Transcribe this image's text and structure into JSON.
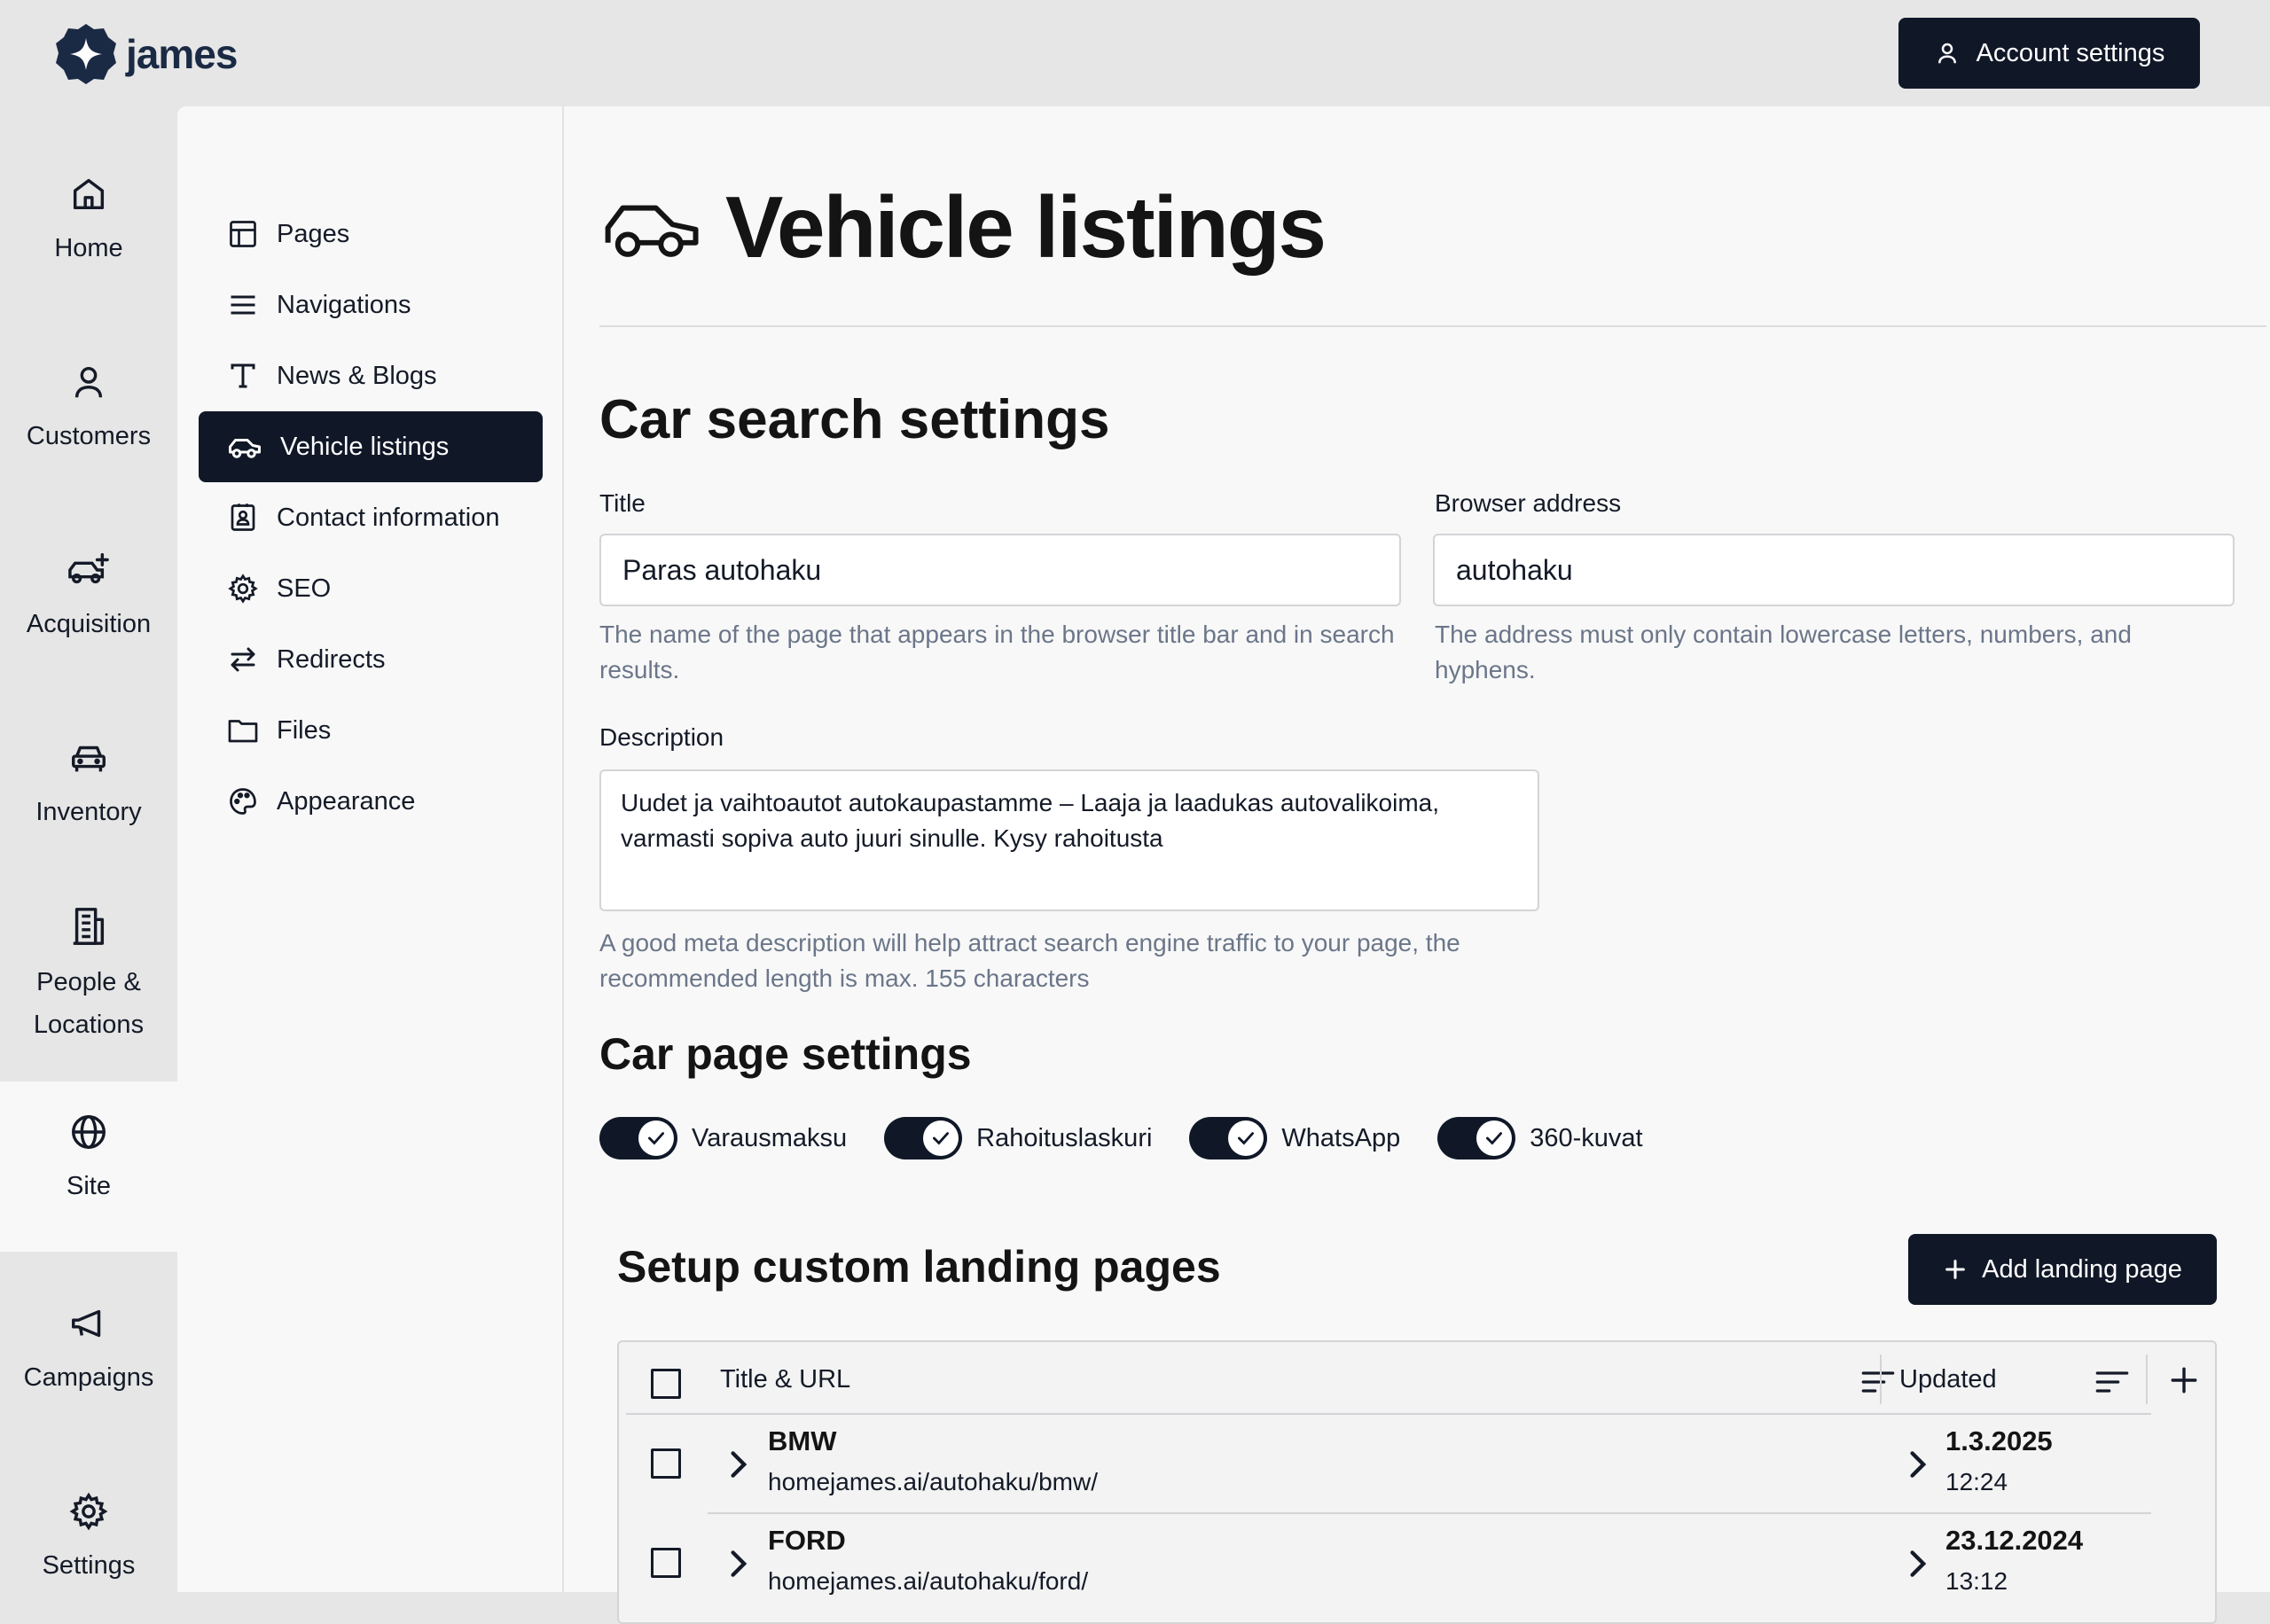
{
  "brand": {
    "name": "james"
  },
  "header": {
    "account_settings": "Account settings"
  },
  "rail": {
    "items": [
      {
        "label": "Home",
        "icon": "home-icon"
      },
      {
        "label": "Customers",
        "icon": "user-icon"
      },
      {
        "label": "Acquisition",
        "icon": "car-plus-icon"
      },
      {
        "label": "Inventory",
        "icon": "car-front-icon"
      },
      {
        "label": "People & Locations",
        "icon": "building-icon"
      },
      {
        "label": "Site",
        "icon": "globe-icon",
        "active": true
      },
      {
        "label": "Campaigns",
        "icon": "megaphone-icon"
      },
      {
        "label": "Settings",
        "icon": "gear-icon"
      }
    ]
  },
  "subnav": {
    "items": [
      {
        "label": "Pages",
        "icon": "layout-icon"
      },
      {
        "label": "Navigations",
        "icon": "menu-icon"
      },
      {
        "label": "News & Blogs",
        "icon": "text-icon"
      },
      {
        "label": "Vehicle listings",
        "icon": "car-icon",
        "active": true
      },
      {
        "label": "Contact information",
        "icon": "contact-card-icon"
      },
      {
        "label": "SEO",
        "icon": "gear-icon"
      },
      {
        "label": "Redirects",
        "icon": "arrows-icon"
      },
      {
        "label": "Files",
        "icon": "folder-icon"
      },
      {
        "label": "Appearance",
        "icon": "palette-icon"
      }
    ]
  },
  "main": {
    "page_title": "Vehicle listings",
    "car_search": {
      "heading": "Car search settings",
      "title_label": "Title",
      "title_value": "Paras autohaku",
      "title_help": "The name of the page that appears in the browser title bar and in search results.",
      "address_label": "Browser address",
      "address_value": "autohaku",
      "address_help": "The address must only contain lowercase letters, numbers, and hyphens.",
      "description_label": "Description",
      "description_value": "Uudet ja vaihtoautot autokaupastamme – Laaja ja laadukas autovalikoima, varmasti sopiva auto juuri sinulle. Kysy rahoitusta",
      "description_help": "A good meta description will help attract search engine traffic to your page, the recommended length is max. 155 characters"
    },
    "car_page": {
      "heading": "Car page settings",
      "toggles": [
        {
          "label": "Varausmaksu",
          "on": true
        },
        {
          "label": "Rahoituslaskuri",
          "on": true
        },
        {
          "label": "WhatsApp",
          "on": true
        },
        {
          "label": "360-kuvat",
          "on": true
        }
      ]
    },
    "landing": {
      "heading": "Setup custom landing pages",
      "add_button": "Add landing page",
      "columns": {
        "title": "Title & URL",
        "updated": "Updated"
      },
      "rows": [
        {
          "title": "BMW",
          "url": "homejames.ai/autohaku/bmw/",
          "date": "1.3.2025",
          "time": "12:24"
        },
        {
          "title": "FORD",
          "url": "homejames.ai/autohaku/ford/",
          "date": "23.12.2024",
          "time": "13:12"
        }
      ]
    }
  },
  "colors": {
    "accent": "#101828",
    "background": "#e6e6e6",
    "panel": "#f8f8f8",
    "muted_text": "#6b7689"
  }
}
